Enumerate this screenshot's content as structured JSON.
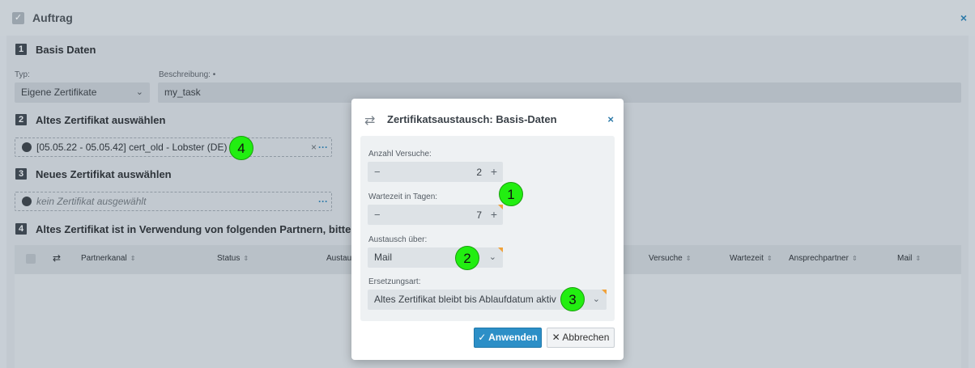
{
  "window": {
    "title": "Auftrag",
    "close_glyph": "×"
  },
  "sections": {
    "s1": {
      "number": "1",
      "title": "Basis Daten"
    },
    "s2": {
      "number": "2",
      "title": "Altes Zertifikat auswählen"
    },
    "s3": {
      "number": "3",
      "title": "Neues Zertifikat auswählen"
    },
    "s4": {
      "number": "4",
      "title": "Altes Zertifikat ist in Verwendung von folgenden Partnern, bitte ggf. a"
    }
  },
  "form": {
    "typ_label": "Typ:",
    "typ_value": "Eigene Zertifikate",
    "beschreibung_label": "Beschreibung: •",
    "beschreibung_value": "my_task"
  },
  "old_cert": {
    "value": "[05.05.22 - 05.05.42] cert_old - Lobster (DE)",
    "clear": "×",
    "more": "···"
  },
  "new_cert": {
    "placeholder": "kein Zertifikat ausgewählt",
    "more": "···"
  },
  "table": {
    "columns": [
      "Partnerkanal",
      "Status",
      "Austau",
      "Versuche",
      "Wartezeit",
      "Ansprechpartner",
      "Mail"
    ],
    "sort_glyph": "⇕",
    "swap_icon": "⇄"
  },
  "modal": {
    "title": "Zertifikatsaustausch: Basis-Daten",
    "icon": "swap-arrows-icon",
    "close": "×",
    "anzahl_label": "Anzahl Versuche:",
    "anzahl_value": "2",
    "wartezeit_label": "Wartezeit in Tagen:",
    "wartezeit_value": "7",
    "austausch_label": "Austausch über:",
    "austausch_value": "Mail",
    "ersetzung_label": "Ersetzungsart:",
    "ersetzung_value": "Altes Zertifikat bleibt bis Ablaufdatum aktiv",
    "apply_label": "✓ Anwenden",
    "cancel_label": "✕ Abbrechen"
  },
  "markers": [
    "1",
    "2",
    "3",
    "4"
  ],
  "colors": {
    "accent": "#2c8fc7",
    "marker": "#22ee11",
    "required_corner": "#f0a23a"
  }
}
